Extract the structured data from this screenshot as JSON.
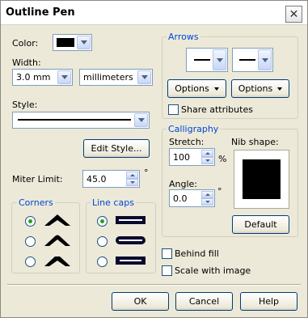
{
  "window": {
    "title": "Outline Pen"
  },
  "color": {
    "label": "Color:",
    "swatch": "#000000"
  },
  "width": {
    "label": "Width:",
    "value": "3.0 mm",
    "unit": "millimeters"
  },
  "style": {
    "label": "Style:",
    "edit_button": "Edit Style..."
  },
  "miter": {
    "label": "Miter Limit:",
    "value": "45.0",
    "unit": "°"
  },
  "corners": {
    "title": "Corners",
    "selected": 0
  },
  "line_caps": {
    "title": "Line caps",
    "selected": 0
  },
  "arrows": {
    "title": "Arrows",
    "options_left": "Options",
    "options_right": "Options",
    "share_label": "Share attributes"
  },
  "calligraphy": {
    "title": "Calligraphy",
    "stretch_label": "Stretch:",
    "stretch_value": "100",
    "stretch_unit": "%",
    "angle_label": "Angle:",
    "angle_value": "0.0",
    "angle_unit": "°",
    "nib_label": "Nib shape:",
    "default_button": "Default"
  },
  "options": {
    "behind_fill": "Behind fill",
    "scale_with_image": "Scale with image"
  },
  "footer": {
    "ok": "OK",
    "cancel": "Cancel",
    "help": "Help"
  }
}
